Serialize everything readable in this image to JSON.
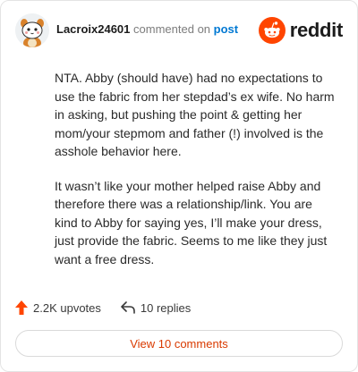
{
  "header": {
    "username": "Lacroix24601",
    "action_text": "commented on",
    "post_link": "post",
    "logo_text": "reddit",
    "avatar_icon": "snoo-avatar-icon",
    "logo_icon": "reddit-snoo-icon"
  },
  "comment": {
    "paragraphs": [
      "NTA. Abby (should have) had no expectations to use the fabric from her stepdad’s ex wife. No harm in asking, but pushing the point & getting her mom/your stepmom and father (!) involved is the asshole behavior here.",
      "It wasn’t like your mother helped raise Abby and therefore there was a relationship/link. You are kind to Abby for saying yes, I’ll make your dress, just provide the fabric. Seems to me like they just want a free dress."
    ]
  },
  "actions": {
    "upvotes": "2.2K upvotes",
    "replies": "10 replies",
    "upvote_icon": "upvote-arrow-icon",
    "reply_icon": "reply-arrow-icon"
  },
  "footer": {
    "view_comments": "View 10 comments"
  },
  "colors": {
    "accent": "#ff4500",
    "link": "#0079d3",
    "button_text": "#d93a00"
  }
}
